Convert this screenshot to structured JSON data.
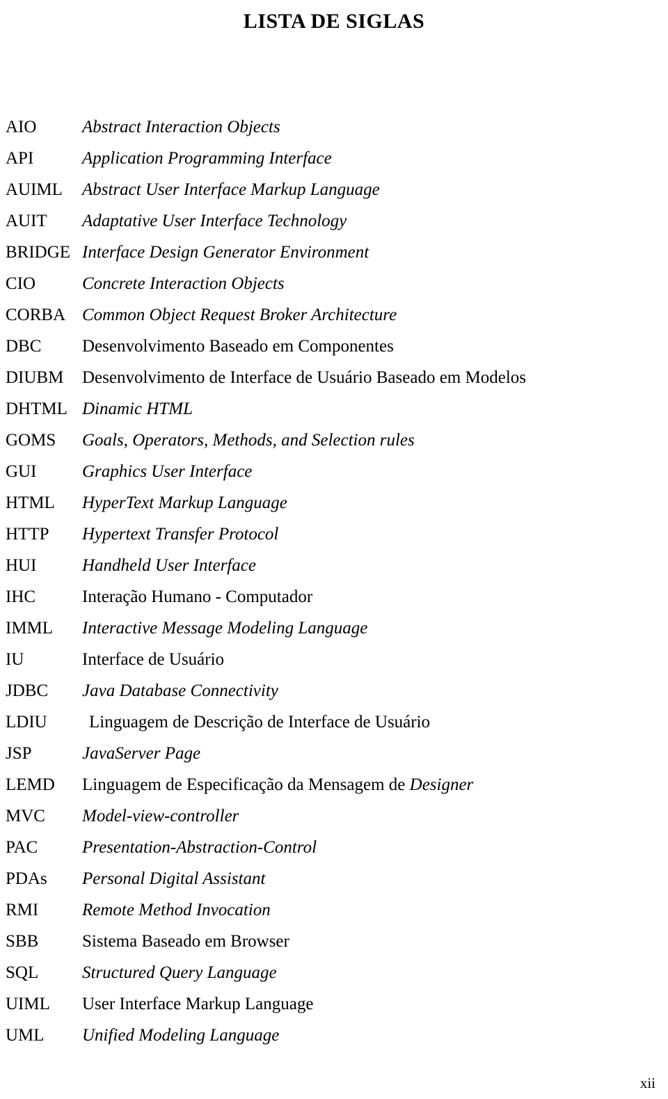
{
  "document": {
    "title": "LISTA DE SIGLAS",
    "page_number": "xii"
  },
  "entries": [
    {
      "abbr": "AIO",
      "desc": "Abstract Interaction Objects",
      "style": "italic"
    },
    {
      "abbr": "API",
      "desc": "Application Programming Interface",
      "style": "italic"
    },
    {
      "abbr": "AUIML",
      "desc": "Abstract User Interface Markup Language",
      "style": "italic"
    },
    {
      "abbr": "AUIT",
      "desc": "Adaptative User Interface Technology",
      "style": "italic"
    },
    {
      "abbr": "BRIDGE",
      "desc": "Interface Design Generator Environment",
      "style": "italic"
    },
    {
      "abbr": "CIO",
      "desc": "Concrete Interaction Objects",
      "style": "italic"
    },
    {
      "abbr": "CORBA",
      "desc": "Common Object Request Broker Architecture",
      "style": "italic"
    },
    {
      "abbr": "DBC",
      "desc": "Desenvolvimento Baseado em Componentes",
      "style": "upright"
    },
    {
      "abbr": "DIUBM",
      "desc": "Desenvolvimento de Interface de Usuário Baseado em Modelos",
      "style": "upright"
    },
    {
      "abbr": "DHTML",
      "desc": "Dinamic HTML",
      "style": "italic"
    },
    {
      "abbr": "GOMS",
      "desc": "Goals, Operators, Methods, and Selection rules",
      "style": "italic"
    },
    {
      "abbr": "GUI",
      "desc": "Graphics User Interface",
      "style": "italic"
    },
    {
      "abbr": "HTML",
      "desc": "HyperText Markup Language",
      "style": "italic"
    },
    {
      "abbr": "HTTP",
      "desc": "Hypertext Transfer Protocol",
      "style": "italic"
    },
    {
      "abbr": "HUI",
      "desc": "Handheld User Interface",
      "style": "italic"
    },
    {
      "abbr": "IHC",
      "desc": "Interação Humano - Computador",
      "style": "upright"
    },
    {
      "abbr": "IMML",
      "desc": "Interactive Message Modeling Language",
      "style": "italic"
    },
    {
      "abbr": "IU",
      "desc": "Interface de Usuário",
      "style": "upright"
    },
    {
      "abbr": "JDBC",
      "desc": "Java Database Connectivity",
      "style": "italic"
    },
    {
      "abbr": "LDIU",
      "desc": "Linguagem de Descrição de Interface de Usuário",
      "style": "upright"
    },
    {
      "abbr": "JSP",
      "desc": "JavaServer Page",
      "style": "italic"
    },
    {
      "abbr": "LEMD",
      "desc": "Linguagem de Especificação da Mensagem de Designer",
      "style": "mixed"
    },
    {
      "abbr": "MVC",
      "desc": "Model-view-controller",
      "style": "italic"
    },
    {
      "abbr": "PAC",
      "desc": "Presentation-Abstraction-Control",
      "style": "italic"
    },
    {
      "abbr": "PDAs",
      "desc": "Personal Digital Assistant",
      "style": "italic"
    },
    {
      "abbr": "RMI",
      "desc": "Remote Method Invocation",
      "style": "italic"
    },
    {
      "abbr": "SBB",
      "desc": "Sistema Baseado em Browser",
      "style": "upright"
    },
    {
      "abbr": "SQL",
      "desc": "Structured Query Language",
      "style": "italic"
    },
    {
      "abbr": "UIML",
      "desc": "User Interface Markup Language",
      "style": "upright"
    },
    {
      "abbr": "UML",
      "desc": "Unified Modeling Language",
      "style": "italic"
    }
  ],
  "lemd_parts": {
    "regular": "Linguagem de Especificação da Mensagem de ",
    "italic": "Designer"
  }
}
